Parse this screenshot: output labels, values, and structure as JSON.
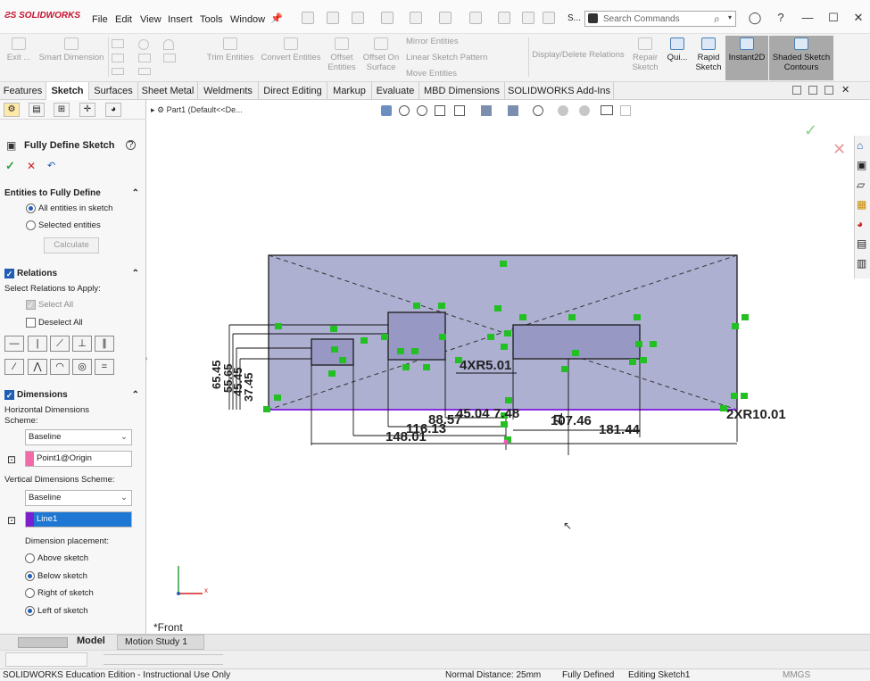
{
  "app": {
    "logo": "SOLIDWORKS"
  },
  "menu": [
    "File",
    "Edit",
    "View",
    "Insert",
    "Tools",
    "Window"
  ],
  "search": {
    "placeholder": "Search Commands",
    "label_s": "S..."
  },
  "commands": {
    "exit": "Exit ...",
    "smart_dimension": "Smart Dimension",
    "trim_entities": "Trim Entities",
    "convert_entities": "Convert Entities",
    "offset_entities": "Offset Entities",
    "offset_on_surface": "Offset On Surface",
    "mirror_entities": "Mirror Entities",
    "linear_sketch_pattern": "Linear Sketch Pattern",
    "move_entities": "Move Entities",
    "display_delete_relations": "Display/Delete Relations",
    "repair_sketch": "Repair Sketch",
    "quick": "Qui...",
    "rapid_sketch": "Rapid Sketch",
    "instant2d": "Instant2D",
    "shaded_sketch_contours": "Shaded Sketch Contours"
  },
  "tabs": [
    "Features",
    "Sketch",
    "Surfaces",
    "Sheet Metal",
    "Weldments",
    "Direct Editing",
    "Markup",
    "Evaluate",
    "MBD Dimensions",
    "SOLIDWORKS Add-Ins"
  ],
  "tree": {
    "part": "Part1",
    "config": "(Default<<De..."
  },
  "panel": {
    "title": "Fully Define Sketch",
    "entities_section": "Entities to Fully Define",
    "all_entities": "All entities in sketch",
    "selected_entities": "Selected entities",
    "calculate": "Calculate",
    "relations_section": "Relations",
    "select_relations": "Select Relations to Apply:",
    "select_all": "Select All",
    "deselect_all": "Deselect All",
    "dimensions_section": "Dimensions",
    "horiz_scheme_label": "Horizontal Dimensions Scheme:",
    "horiz_scheme_value": "Baseline",
    "horiz_ref": "Point1@Origin",
    "vert_scheme_label": "Vertical Dimensions Scheme:",
    "vert_scheme_value": "Baseline",
    "vert_ref": "Line1",
    "placement_label": "Dimension placement:",
    "above": "Above sketch",
    "below": "Below sketch",
    "right": "Right of sketch",
    "left": "Left of sketch"
  },
  "view": {
    "name": "*Front"
  },
  "dimensions": {
    "d4xr": "4XR5.01",
    "d2xr": "2XR10.01",
    "h116": "116.13",
    "h88": "88.57",
    "h148": "148.01",
    "h45": "45.04",
    "h7": "7.48",
    "h107": "107.46",
    "h181": "181.44",
    "h21": "21",
    "v65": "65.45",
    "v55": "55.65",
    "v45": "45.45",
    "v37": "37.45"
  },
  "model_tabs": {
    "model": "Model",
    "motion": "Motion Study 1"
  },
  "status": {
    "edition": "SOLIDWORKS Education Edition - Instructional Use Only",
    "normal_distance": "Normal Distance: 25mm",
    "state": "Fully Defined",
    "editing": "Editing Sketch1",
    "units": "MMGS"
  },
  "colors": {
    "accent": "#1f5eb4",
    "relation": "#22c022",
    "origin_line": "#8a2be2",
    "part_fill": "#aeb0d2"
  }
}
